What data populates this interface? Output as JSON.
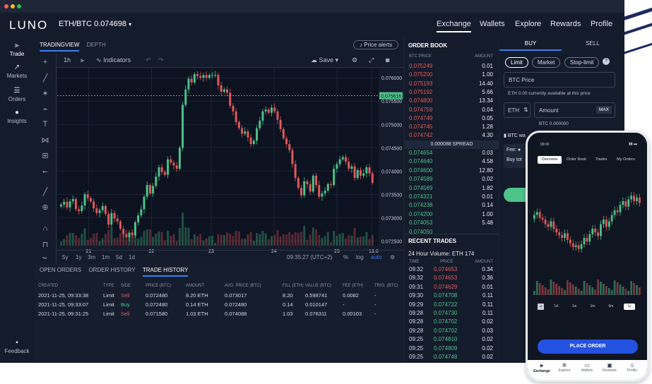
{
  "app": {
    "logo": "LUNO",
    "pair_label": "ETH/BTC 0.074698",
    "nav": [
      "Exchange",
      "Wallets",
      "Explore",
      "Rewards",
      "Profile"
    ]
  },
  "sidebar": {
    "items": [
      {
        "label": "Trade",
        "icon": "candles-icon"
      },
      {
        "label": "Markets",
        "icon": "trend-icon"
      },
      {
        "label": "Orders",
        "icon": "list-icon"
      },
      {
        "label": "Insights",
        "icon": "bulb-icon"
      }
    ],
    "feedback": "Feedback"
  },
  "chart_panel": {
    "tabs": [
      "TRADINGVIEW",
      "DEPTH"
    ],
    "price_alerts": "Price alerts",
    "interval": "1h",
    "indicators": "Indicators",
    "save": "Save",
    "symbol": "ETH/BTC, 60",
    "ohlc": {
      "o_label": "O",
      "o": "0.075616",
      "h_label": "H",
      "h": "0.075616",
      "l_label": "L",
      "l": "0.075616",
      "c_label": "C",
      "c": "0.075616",
      "change": "+0.000944 (+1.26%)"
    },
    "volume_label": "Volume (20)",
    "volume_value": "0",
    "volume_na": "n/a",
    "last_price": "0.075616",
    "ranges": [
      "5y",
      "1y",
      "3m",
      "1m",
      "5d",
      "1d"
    ],
    "clock": "09:35:27 (UTC+2)",
    "scale_opts": [
      "%",
      "log",
      "auto"
    ]
  },
  "chart_data": {
    "type": "candlestick",
    "y_ticks": [
      "0.076000",
      "0.075500",
      "0.075000",
      "0.074500",
      "0.074000",
      "0.073500",
      "0.073000",
      "0.072500"
    ],
    "ylim": [
      0.0724,
      0.0762
    ],
    "x_ticks": [
      "21",
      "22",
      "23",
      "24",
      "25",
      "13:0"
    ],
    "close": [
      0.07328,
      0.07334,
      0.07322,
      0.07335,
      0.0734,
      0.07318,
      0.07314,
      0.07326,
      0.0735,
      0.07342,
      0.07335,
      0.0732,
      0.0731,
      0.07316,
      0.07325,
      0.07308,
      0.07285,
      0.0731,
      0.07298,
      0.07292,
      0.07276,
      0.07265,
      0.07258,
      0.07268,
      0.07262,
      0.0729,
      0.07305,
      0.07318,
      0.07345,
      0.0737,
      0.07352,
      0.07368,
      0.07388,
      0.07408,
      0.07398,
      0.07392,
      0.07425,
      0.07418,
      0.07412,
      0.07405,
      0.0745,
      0.07542,
      0.07575,
      0.07598,
      0.0759,
      0.07608,
      0.07604,
      0.076,
      0.07606,
      0.076,
      0.07606,
      0.07606,
      0.07606,
      0.07584,
      0.0757,
      0.07575,
      0.07568,
      0.0754,
      0.07528,
      0.07505,
      0.07492,
      0.0748,
      0.07485,
      0.07472,
      0.07458,
      0.07465,
      0.07492,
      0.07508,
      0.07528,
      0.07532,
      0.07525,
      0.07536,
      0.07528,
      0.0751,
      0.0749,
      0.0747,
      0.07458,
      0.07445,
      0.07415,
      0.07385,
      0.07364,
      0.07348,
      0.07378,
      0.07372,
      0.07356,
      0.0739,
      0.0737,
      0.07345,
      0.07352,
      0.07358,
      0.07372,
      0.0737,
      0.07405,
      0.07415,
      0.07425,
      0.0743,
      0.0742,
      0.07405,
      0.0741,
      0.07385,
      0.07402,
      0.0739,
      0.07395,
      0.07408,
      0.07395,
      0.07375
    ]
  },
  "trade_history": {
    "tabs": [
      "OPEN ORDERS",
      "ORDER HISTORY",
      "TRADE HISTORY"
    ],
    "columns": [
      "CREATED",
      "TYPE",
      "SIDE",
      "PRICE (BTC)",
      "AMOUNT",
      "AVG. PRICE (BTC)",
      "FILL (ETH)",
      "VALUE (BTC)",
      "FEE (ETH)",
      "TRIG. (BTC)"
    ],
    "rows": [
      {
        "created": "2021-11-25, 09:33:38",
        "type": "Limit",
        "side": "Sell",
        "price": "0.072480",
        "amount": "8.20 ETH",
        "avg": "0.073017",
        "fill": "8.20",
        "value": "0.598741",
        "fee": "0.0082",
        "trig": "-"
      },
      {
        "created": "2021-11-25, 09:33:07",
        "type": "Limit",
        "side": "Buy",
        "price": "0.072480",
        "amount": "0.14 ETH",
        "avg": "0.072480",
        "fill": "0.14",
        "value": "0.010147",
        "fee": "-",
        "trig": "-"
      },
      {
        "created": "2021-11-25, 09:31:25",
        "type": "Limit",
        "side": "Sell",
        "price": "0.071580",
        "amount": "1.03 ETH",
        "avg": "0.074088",
        "fill": "1.03",
        "value": "0.076311",
        "fee": "0.00103",
        "trig": "-"
      }
    ]
  },
  "order_book": {
    "title": "ORDER BOOK",
    "col_price": "BTC PRICE",
    "col_amount": "AMOUNT",
    "asks": [
      {
        "price": "0.075249",
        "amount": "0.01"
      },
      {
        "price": "0.075200",
        "amount": "1.00"
      },
      {
        "price": "0.075193",
        "amount": "14.40"
      },
      {
        "price": "0.075192",
        "amount": "5.66"
      },
      {
        "price": "0.074800",
        "amount": "13.34"
      },
      {
        "price": "0.074759",
        "amount": "0.04"
      },
      {
        "price": "0.074749",
        "amount": "0.05"
      },
      {
        "price": "0.074745",
        "amount": "1.28"
      },
      {
        "price": "0.074742",
        "amount": "4.30"
      }
    ],
    "spread": "0.000088 SPREAD",
    "bids": [
      {
        "price": "0.074654",
        "amount": "0.03"
      },
      {
        "price": "0.074640",
        "amount": "4.58"
      },
      {
        "price": "0.074600",
        "amount": "12.80"
      },
      {
        "price": "0.074589",
        "amount": "0.02"
      },
      {
        "price": "0.074569",
        "amount": "1.82"
      },
      {
        "price": "0.074321",
        "amount": "0.01"
      },
      {
        "price": "0.074238",
        "amount": "0.14"
      },
      {
        "price": "0.074200",
        "amount": "1.00"
      },
      {
        "price": "0.074053",
        "amount": "5.48"
      },
      {
        "price": "0.074050",
        "amount": ""
      }
    ]
  },
  "recent_trades": {
    "title": "RECENT TRADES",
    "volume": "24 Hour Volume: ETH 174",
    "col_time": "TIME",
    "col_price": "PRICE",
    "col_amount": "AMOUNT",
    "rows": [
      {
        "time": "09:32",
        "price": "0.074653",
        "amount": "0.34",
        "side": "sell"
      },
      {
        "time": "09:32",
        "price": "0.074653",
        "amount": "0.36",
        "side": "sell"
      },
      {
        "time": "09:31",
        "price": "0.074629",
        "amount": "0.01",
        "side": "sell"
      },
      {
        "time": "09:30",
        "price": "0.074708",
        "amount": "0.11",
        "side": "buy"
      },
      {
        "time": "09:29",
        "price": "0.074722",
        "amount": "0.11",
        "side": "buy"
      },
      {
        "time": "09:28",
        "price": "0.074730",
        "amount": "0.11",
        "side": "buy"
      },
      {
        "time": "09:28",
        "price": "0.074702",
        "amount": "0.02",
        "side": "buy"
      },
      {
        "time": "09:28",
        "price": "0.074702",
        "amount": "0.03",
        "side": "buy"
      },
      {
        "time": "09:25",
        "price": "0.074810",
        "amount": "0.02",
        "side": "buy"
      },
      {
        "time": "09:25",
        "price": "0.074809",
        "amount": "0.02",
        "side": "buy"
      },
      {
        "time": "09:25",
        "price": "0.074748",
        "amount": "0.02",
        "side": "buy"
      }
    ]
  },
  "buy_sell": {
    "tabs": [
      "BUY",
      "SELL"
    ],
    "order_types": [
      "Limit",
      "Market",
      "Stop-limit"
    ],
    "price_placeholder": "BTC Price",
    "available": "ETH 0.00 currently available at this price",
    "currency": "ETH",
    "amount_placeholder": "Amount",
    "max": "MAX",
    "btc_amount": "BTC 0.000000",
    "wallet_label": "BTC wa",
    "fee_label": "Fee:",
    "buy_total": "Buy tot"
  },
  "phone": {
    "time": "09:00",
    "tabs": [
      "Overview",
      "Order Book",
      "Trades",
      "My Orders"
    ],
    "ranges": [
      "1d",
      "1w",
      "1m",
      "6m",
      "1y"
    ],
    "place_order": "PLACE ORDER",
    "nav": [
      "Exchange",
      "Explore",
      "Wallets",
      "Rewards",
      "Profile"
    ],
    "close": [
      0.55,
      0.58,
      0.52,
      0.5,
      0.45,
      0.42,
      0.48,
      0.4,
      0.36,
      0.33,
      0.3,
      0.35,
      0.28,
      0.24,
      0.2,
      0.22,
      0.18,
      0.23,
      0.3,
      0.26,
      0.34,
      0.4,
      0.36,
      0.32,
      0.45,
      0.5,
      0.42,
      0.48,
      0.55,
      0.6,
      0.58,
      0.66,
      0.7,
      0.64,
      0.72,
      0.76,
      0.7,
      0.74,
      0.68
    ]
  }
}
